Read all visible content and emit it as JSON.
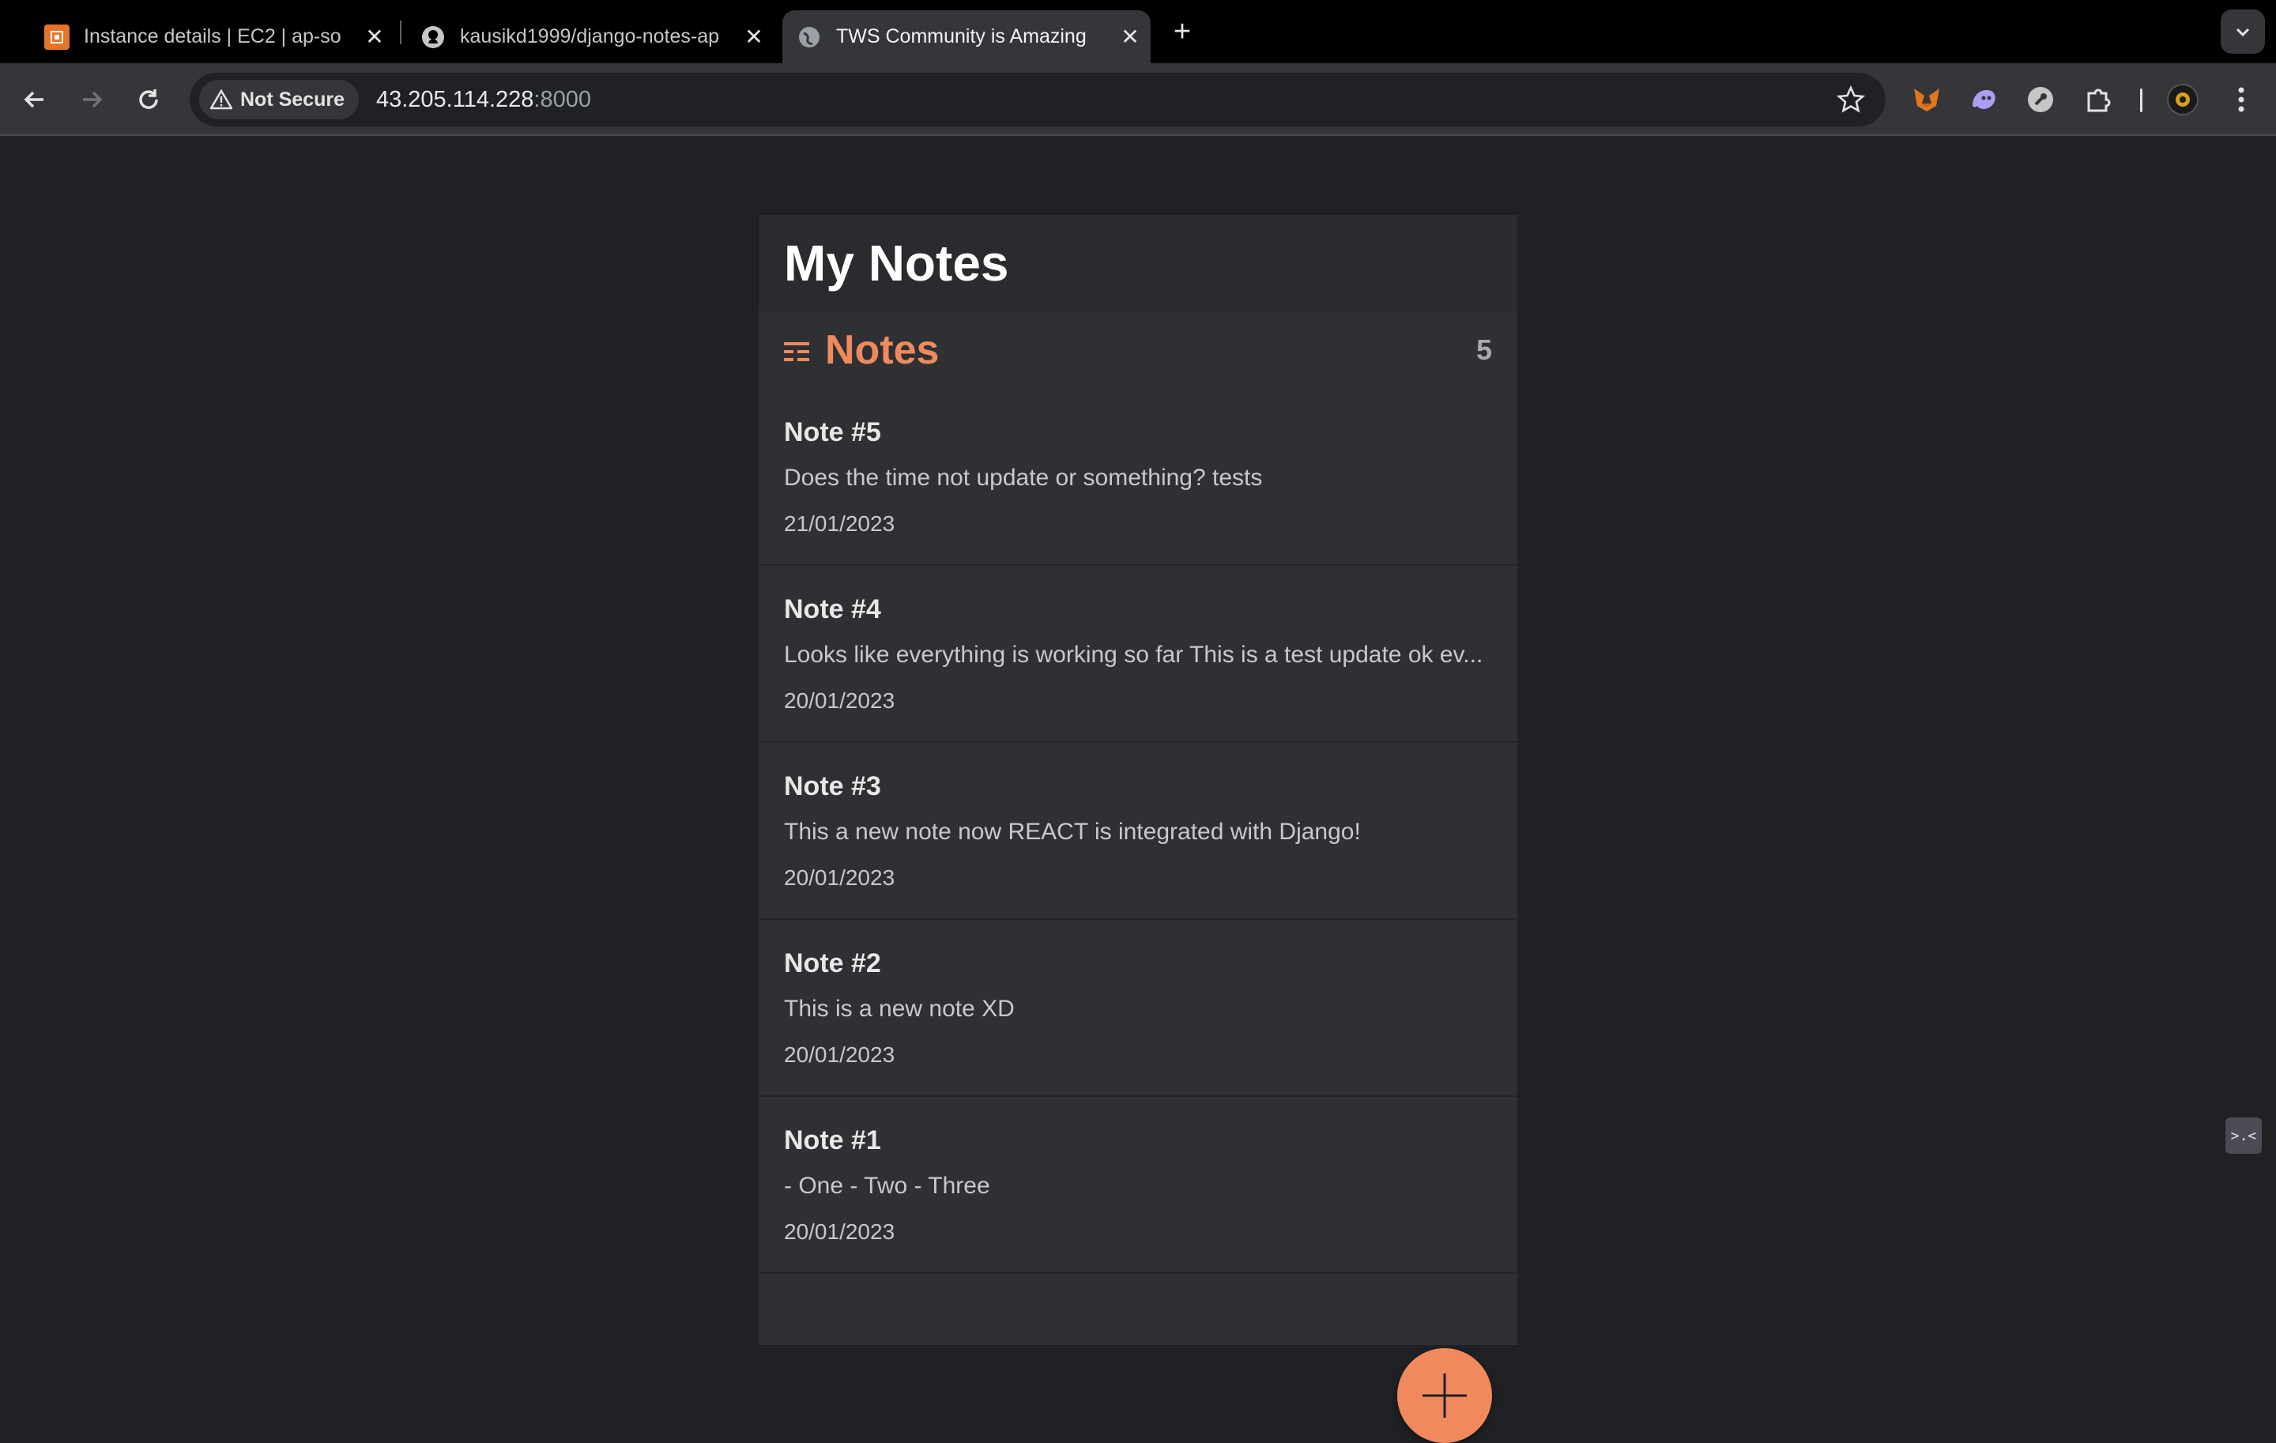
{
  "browser": {
    "tabs": [
      {
        "title": "Instance details | EC2 | ap-so",
        "icon": "aws-ec2-icon",
        "active": false
      },
      {
        "title": "kausikd1999/django-notes-ap",
        "icon": "github-icon",
        "active": false
      },
      {
        "title": "TWS Community is Amazing",
        "icon": "globe-icon",
        "active": true
      }
    ],
    "security_label": "Not Secure",
    "url_host": "43.205.114.228",
    "url_port": ":8000"
  },
  "app": {
    "title": "My Notes",
    "notes_heading": "Notes",
    "notes_count": "5",
    "notes": [
      {
        "title": "Note #5",
        "body": "Does the time not update or something? tests",
        "date": "21/01/2023"
      },
      {
        "title": "Note #4",
        "body": "Looks like everything is working so far This is a test update ok ev...",
        "date": "20/01/2023"
      },
      {
        "title": "Note #3",
        "body": "This a new note now REACT is integrated with Django!",
        "date": "20/01/2023"
      },
      {
        "title": "Note #2",
        "body": "This is a new note XD",
        "date": "20/01/2023"
      },
      {
        "title": "Note #1",
        "body": "- One - Two - Three",
        "date": "20/01/2023"
      }
    ],
    "accent_color": "#f08a5d"
  },
  "side_widget_label": ">.<"
}
